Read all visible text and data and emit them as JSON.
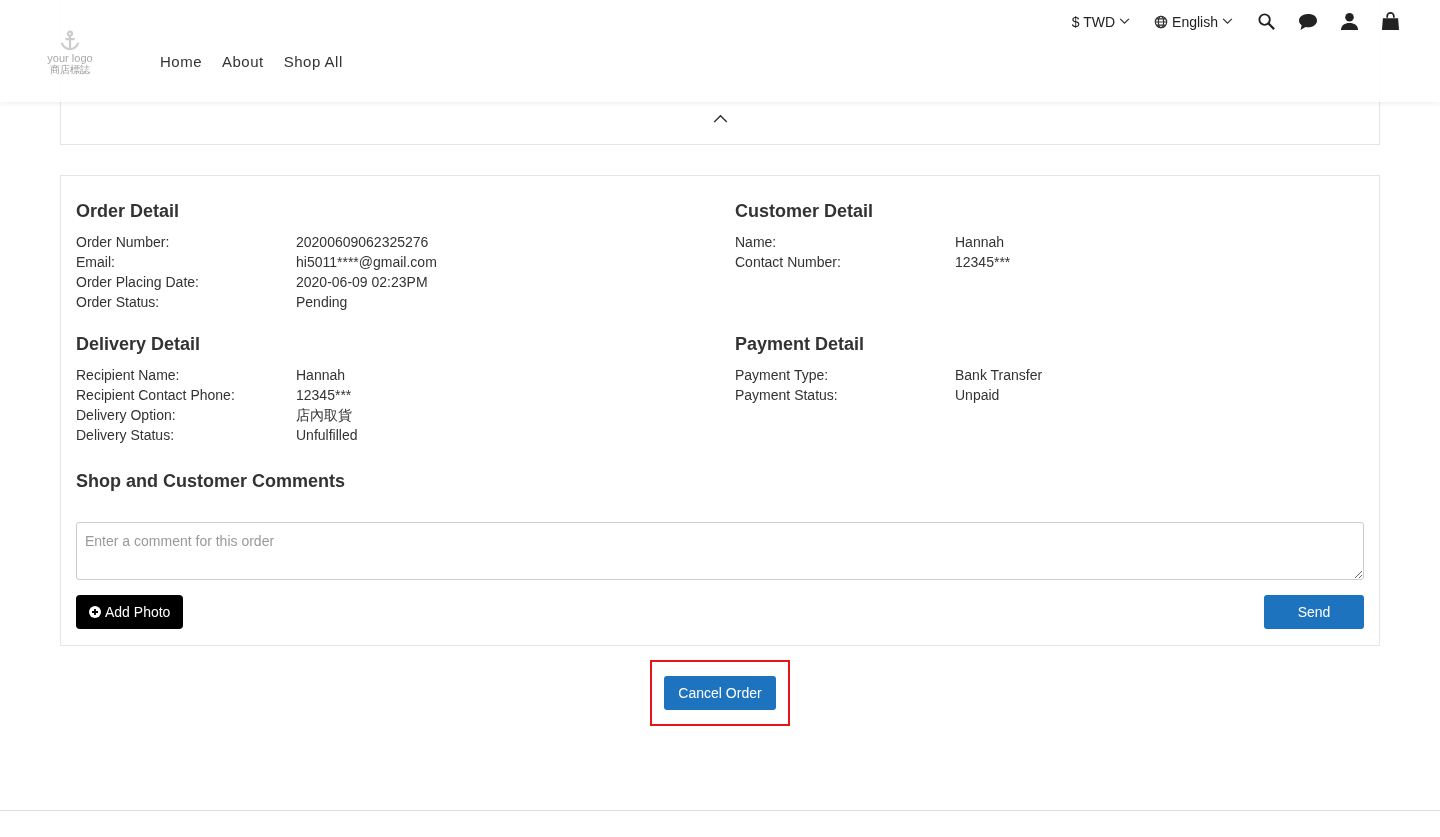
{
  "header": {
    "logo": {
      "text": "your logo",
      "subtext": "商店標誌"
    },
    "nav": [
      "Home",
      "About",
      "Shop All"
    ],
    "currency": "$ TWD",
    "language": "English"
  },
  "sections": [
    {
      "title": "Order Detail",
      "rows": [
        {
          "label": "Order Number:",
          "value": "20200609062325276"
        },
        {
          "label": "Email:",
          "value": "hi5011****@gmail.com"
        },
        {
          "label": "Order Placing Date:",
          "value": "2020-06-09 02:23PM"
        },
        {
          "label": "Order Status:",
          "value": "Pending"
        }
      ]
    },
    {
      "title": "Customer Detail",
      "rows": [
        {
          "label": "Name:",
          "value": "Hannah"
        },
        {
          "label": "Contact Number:",
          "value": "12345***"
        }
      ]
    },
    {
      "title": "Delivery Detail",
      "rows": [
        {
          "label": "Recipient Name:",
          "value": "Hannah"
        },
        {
          "label": "Recipient Contact Phone:",
          "value": "12345***"
        },
        {
          "label": "Delivery Option:",
          "value": "店內取貨"
        },
        {
          "label": "Delivery Status:",
          "value": "Unfulfilled"
        }
      ]
    },
    {
      "title": "Payment Detail",
      "rows": [
        {
          "label": "Payment Type:",
          "value": "Bank Transfer"
        },
        {
          "label": "Payment Status:",
          "value": "Unpaid"
        }
      ]
    }
  ],
  "comments": {
    "title": "Shop and Customer Comments",
    "placeholder": "Enter a comment for this order",
    "add_photo": "Add Photo",
    "send": "Send"
  },
  "cancel_button": {
    "label": "Cancel Order",
    "highlighted": true
  }
}
